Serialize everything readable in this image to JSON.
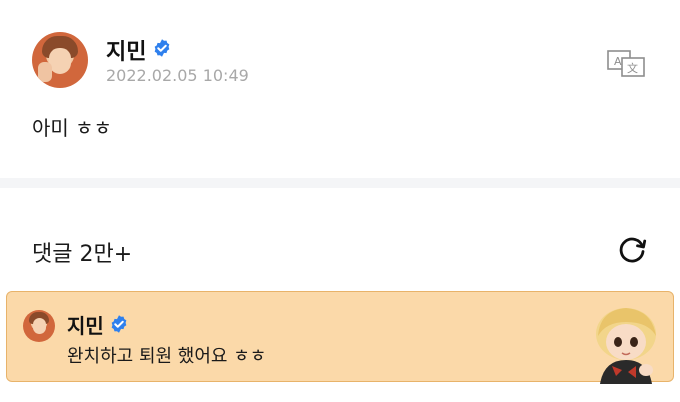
{
  "post": {
    "author": "지민",
    "timestamp": "2022.02.05 10:49",
    "text": "아미 ㅎㅎ",
    "translate_icon": "translate-icon"
  },
  "comments": {
    "title": "댓글 2만+",
    "refresh_icon": "refresh-icon"
  },
  "pinned_comment": {
    "author": "지민",
    "text": "완치하고 퇴원 했어요 ㅎㅎ"
  },
  "colors": {
    "verified": "#2f80ed",
    "highlight_bg": "#fbd9a9",
    "highlight_border": "#e8b36a",
    "timestamp": "#a8a8a8",
    "divider": "#f4f5f7"
  }
}
